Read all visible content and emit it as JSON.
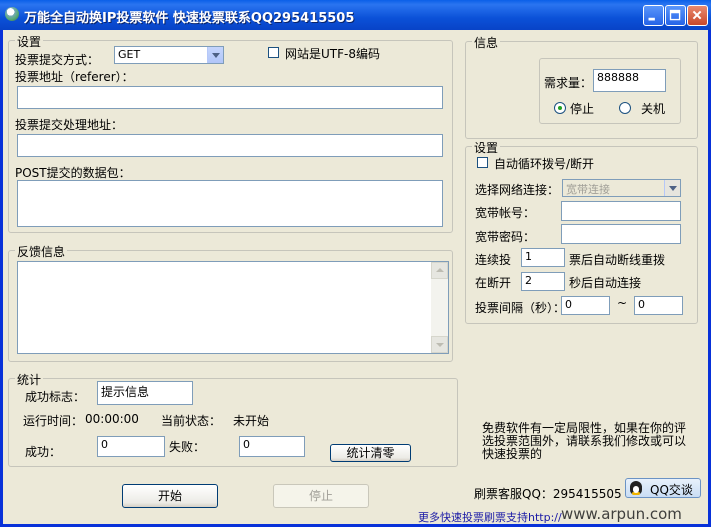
{
  "window": {
    "title": "万能全自动换IP投票软件 快速投票联系QQ295415505"
  },
  "settings": {
    "group_label": "设置",
    "method_label": "投票提交方式：",
    "method_value": "GET",
    "utf8_label": "网站是UTF-8编码",
    "referer_label": "投票地址（referer）：",
    "referer_value": "",
    "process_url_label": "投票提交处理地址：",
    "process_url_value": "",
    "post_label": "POST提交的数据包：",
    "post_value": ""
  },
  "feedback": {
    "group_label": "反馈信息",
    "content": ""
  },
  "stats": {
    "group_label": "统计",
    "success_flag_label": "成功标志：",
    "success_flag_value": "提示信息",
    "runtime_label": "运行时间：",
    "runtime_value": "00:00:00",
    "status_label": "当前状态：",
    "status_value": "未开始",
    "success_label": "成功：",
    "success_value": "0",
    "fail_label": "失败：",
    "fail_value": "0",
    "clear_button": "统计清零"
  },
  "buttons": {
    "start": "开始",
    "stop": "停止"
  },
  "info": {
    "group_label": "信息",
    "demand_label": "需求量：",
    "demand_value": "888888",
    "radio_stop": "停止",
    "radio_shutdown": "关机"
  },
  "net": {
    "group_label": "设置",
    "auto_dial_label": "自动循环拨号/断开",
    "connection_label": "选择网络连接：",
    "connection_value": "宽带连接",
    "account_label": "宽带帐号：",
    "account_value": "",
    "password_label": "宽带密码：",
    "password_value": "",
    "continuous_label": "连续投",
    "continuous_value": "1",
    "continuous_suffix": "票后自动断线重拨",
    "disconnect_label": "在断开",
    "disconnect_value": "2",
    "disconnect_suffix": "秒后自动连接",
    "interval_label": "投票间隔（秒）：",
    "interval_from": "0",
    "interval_sep": "~",
    "interval_to": "0"
  },
  "notice": {
    "line1": "免费软件有一定局限性，如果在你的评",
    "line2": "选投票范围外，请联系我们修改或可以",
    "line3": "快速投票的"
  },
  "support": {
    "qq_text": "刷票客服QQ：295415505",
    "qq_button": "QQ交谈",
    "link": "更多快速投票刷票支持http://",
    "watermark": "www.arpun.com"
  }
}
